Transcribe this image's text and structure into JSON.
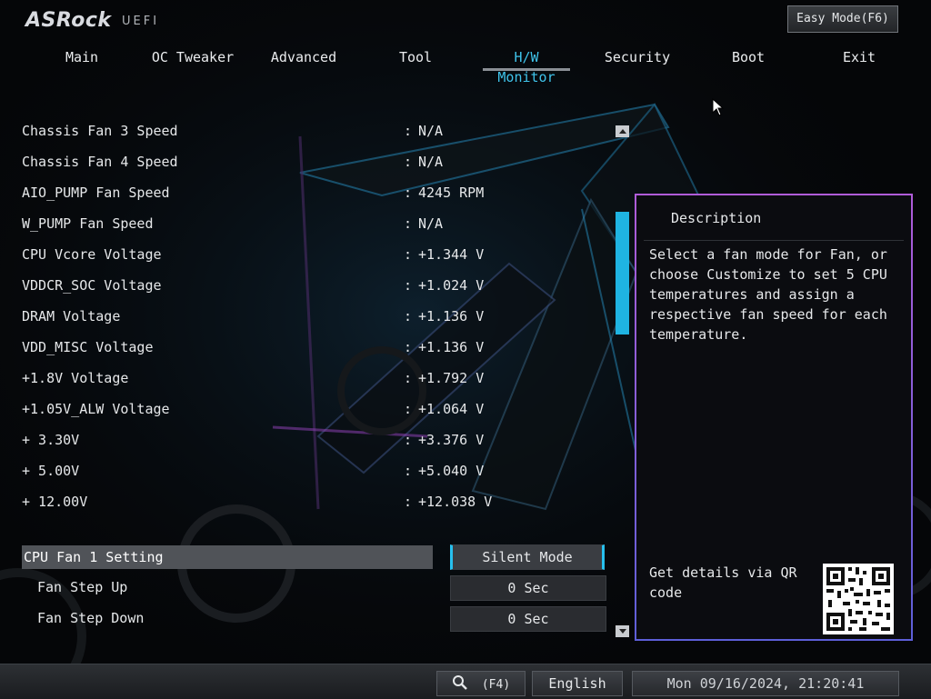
{
  "header": {
    "brand": "ASRock",
    "subtitle": "UEFI",
    "easy_mode_label": "Easy Mode(F6)"
  },
  "tabs": [
    {
      "label": "Main"
    },
    {
      "label": "OC Tweaker"
    },
    {
      "label": "Advanced"
    },
    {
      "label": "Tool"
    },
    {
      "label": "H/W Monitor",
      "active": true
    },
    {
      "label": "Security"
    },
    {
      "label": "Boot"
    },
    {
      "label": "Exit"
    }
  ],
  "monitor": {
    "separator": ":",
    "items": [
      {
        "label": "Chassis Fan 3 Speed",
        "value": "N/A"
      },
      {
        "label": "Chassis Fan 4 Speed",
        "value": "N/A"
      },
      {
        "label": "AIO_PUMP Fan Speed",
        "value": "4245 RPM"
      },
      {
        "label": "W_PUMP Fan Speed",
        "value": "N/A"
      },
      {
        "label": "CPU Vcore Voltage",
        "value": "+1.344 V"
      },
      {
        "label": "VDDCR_SOC Voltage",
        "value": "+1.024 V"
      },
      {
        "label": "DRAM Voltage",
        "value": "+1.136 V"
      },
      {
        "label": "VDD_MISC Voltage",
        "value": "+1.136 V"
      },
      {
        "label": "+1.8V Voltage",
        "value": "+1.792 V"
      },
      {
        "label": "+1.05V_ALW Voltage",
        "value": "+1.064 V"
      },
      {
        "label": "+ 3.30V",
        "value": "+3.376 V"
      },
      {
        "label": "+ 5.00V",
        "value": "+5.040 V"
      },
      {
        "label": "+ 12.00V",
        "value": "+12.038 V"
      }
    ]
  },
  "settings": {
    "fan1_label": "CPU Fan 1 Setting",
    "fan1_value": "Silent Mode",
    "step_up_label": "Fan Step Up",
    "step_up_value": "0 Sec",
    "step_down_label": "Fan Step Down",
    "step_down_value": "0 Sec"
  },
  "description": {
    "title": "Description",
    "text": "Select a fan mode for Fan, or choose Customize to set 5 CPU temperatures and assign a respective fan speed for each temperature.",
    "qr_text": "Get details via QR code"
  },
  "footer": {
    "search_key": "(F4)",
    "language": "English",
    "datetime": "Mon 09/16/2024, 21:20:41"
  },
  "colors": {
    "accent": "#27c0ee",
    "panel_border_top": "#b05cd8",
    "panel_border_bottom": "#5d5fd8",
    "highlight_row": "#505358"
  },
  "icons": {
    "search": "search-icon",
    "scroll_up": "chevron-up-icon",
    "scroll_down": "chevron-down-icon",
    "qr": "qr-code-icon"
  }
}
